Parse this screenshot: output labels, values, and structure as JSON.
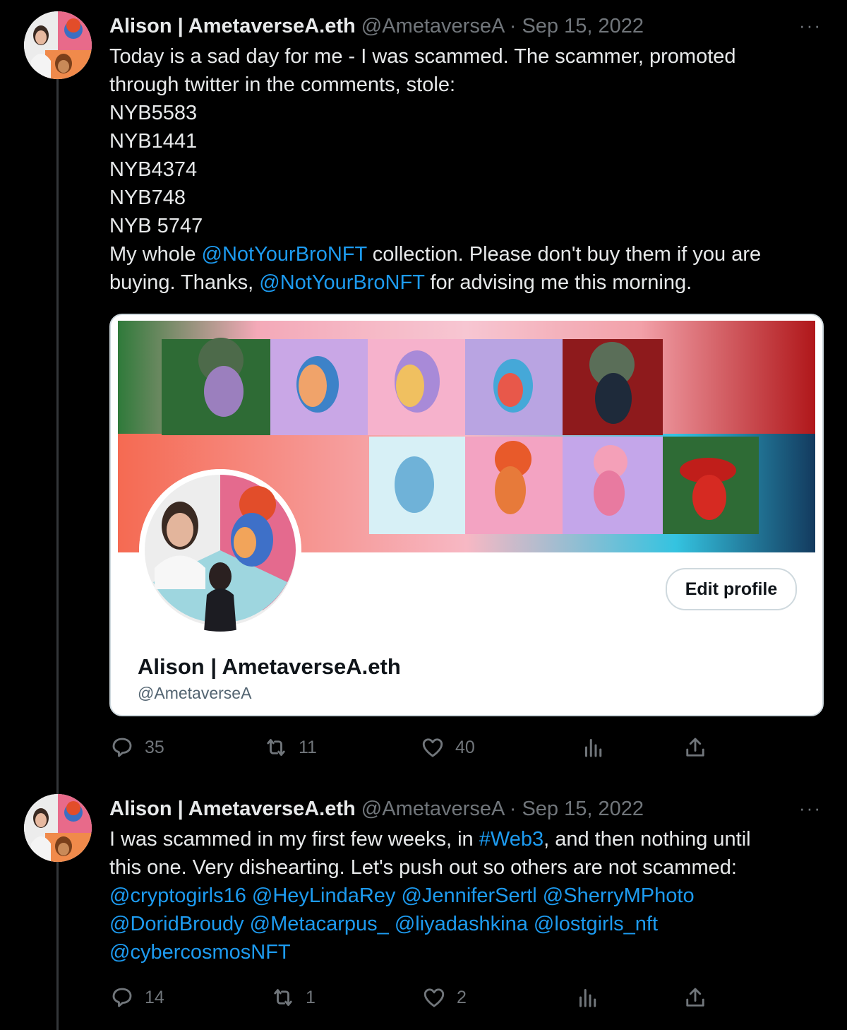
{
  "tweets": [
    {
      "name": "Alison | AmetaverseA.eth",
      "meta": "@AmetaverseA · Sep 15, 2022",
      "more": "···",
      "body": {
        "l1": "Today is a sad day for me - I was scammed.  The scammer, promoted",
        "l2": "through twitter in the comments, stole:",
        "l3": "NYB5583",
        "l4": "NYB1441",
        "l5": "NYB4374",
        "l6": "NYB748",
        "l7": "NYB 5747",
        "l8a": "My whole ",
        "l8m": "@NotYourBroNFT",
        "l8b": " collection.  Please don't buy them if you are",
        "l9a": "buying.  Thanks, ",
        "l9m": "@NotYourBroNFT",
        "l9b": " for advising me this morning."
      },
      "card": {
        "edit_label": "Edit profile",
        "name": "Alison | AmetaverseA.eth",
        "handle": "@AmetaverseA"
      },
      "actions": {
        "replies": "35",
        "retweets": "11",
        "likes": "40"
      }
    },
    {
      "name": "Alison | AmetaverseA.eth",
      "meta": "@AmetaverseA · Sep 15, 2022",
      "more": "···",
      "body": {
        "l1a": "I was scammed in my first few weeks, in ",
        "l1m": "#Web3",
        "l1b": ", and then nothing until",
        "l2": "this one.  Very dishearting.  Let's push out so others are not scammed:",
        "l3": "@cryptogirls16 @HeyLindaRey @JenniferSertl @SherryMPhoto",
        "l4": "@DoridBroudy  @Metacarpus_ @liyadashkina @lostgirls_nft",
        "l5": "@cybercosmosNFT"
      },
      "actions": {
        "replies": "14",
        "retweets": "1",
        "likes": "2"
      }
    }
  ],
  "icons": [
    "reply-icon",
    "retweet-icon",
    "like-icon",
    "views-icon",
    "share-icon",
    "more-icon"
  ],
  "colors": {
    "background": "#000000",
    "link": "#1d9bf0",
    "muted": "#71767b",
    "text": "#e7e9ea"
  }
}
